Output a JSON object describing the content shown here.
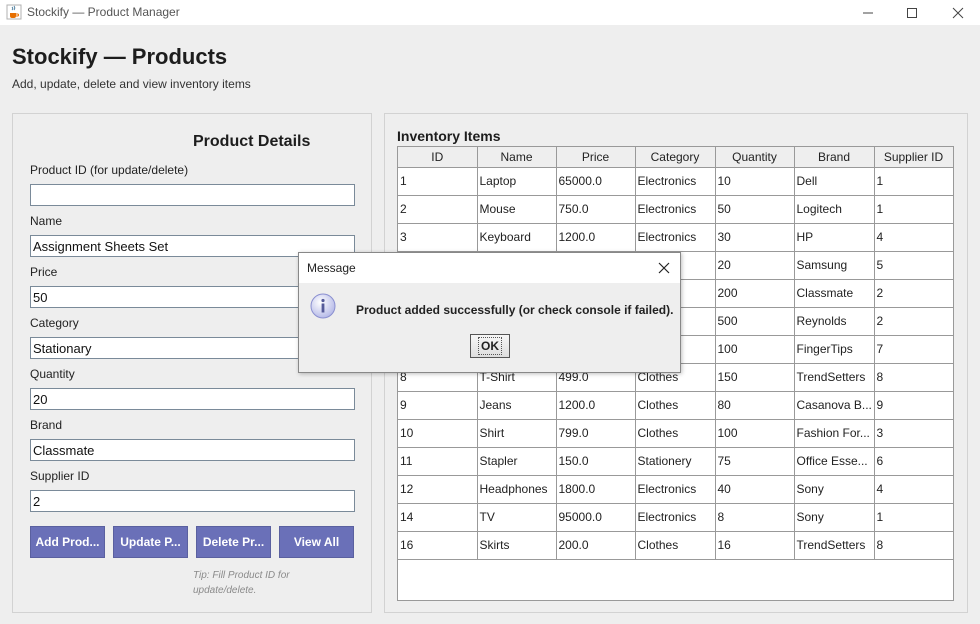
{
  "window": {
    "title": "Stockify — Product Manager",
    "icon": "java-cup-icon"
  },
  "header": {
    "title": "Stockify — Products",
    "subtitle": "Add, update, delete and view inventory items"
  },
  "details": {
    "title": "Product Details",
    "fields": {
      "product_id": {
        "label": "Product ID (for update/delete)",
        "value": ""
      },
      "name": {
        "label": "Name",
        "value": "Assignment Sheets Set"
      },
      "price": {
        "label": "Price",
        "value": "50"
      },
      "category": {
        "label": "Category",
        "value": "Stationary"
      },
      "quantity": {
        "label": "Quantity",
        "value": "20"
      },
      "brand": {
        "label": "Brand",
        "value": "Classmate"
      },
      "supplier_id": {
        "label": "Supplier ID",
        "value": "2"
      }
    },
    "buttons": {
      "add": "Add Prod...",
      "update": "Update P...",
      "delete": "Delete Pr...",
      "view_all": "View All"
    },
    "tip": "Tip: Fill Product ID for update/delete."
  },
  "inventory": {
    "title": "Inventory Items",
    "columns": [
      "ID",
      "Name",
      "Price",
      "Category",
      "Quantity",
      "Brand",
      "Supplier ID"
    ],
    "rows": [
      [
        "1",
        "Laptop",
        "65000.0",
        "Electronics",
        "10",
        "Dell",
        "1"
      ],
      [
        "2",
        "Mouse",
        "750.0",
        "Electronics",
        "50",
        "Logitech",
        "1"
      ],
      [
        "3",
        "Keyboard",
        "1200.0",
        "Electronics",
        "30",
        "HP",
        "4"
      ],
      [
        "",
        "",
        "",
        "ics",
        "20",
        "Samsung",
        "5"
      ],
      [
        "",
        "",
        "",
        "ry",
        "200",
        "Classmate",
        "2"
      ],
      [
        "",
        "",
        "",
        "ry",
        "500",
        "Reynolds",
        "2"
      ],
      [
        "",
        "",
        "",
        "ry",
        "100",
        "FingerTips",
        "7"
      ],
      [
        "8",
        "T-Shirt",
        "499.0",
        "Clothes",
        "150",
        "TrendSetters",
        "8"
      ],
      [
        "9",
        "Jeans",
        "1200.0",
        "Clothes",
        "80",
        "Casanova B...",
        "9"
      ],
      [
        "10",
        "Shirt",
        "799.0",
        "Clothes",
        "100",
        "Fashion For...",
        "3"
      ],
      [
        "11",
        "Stapler",
        "150.0",
        "Stationery",
        "75",
        "Office Esse...",
        "6"
      ],
      [
        "12",
        "Headphones",
        "1800.0",
        "Electronics",
        "40",
        "Sony",
        "4"
      ],
      [
        "14",
        "TV",
        "95000.0",
        "Electronics",
        "8",
        "Sony",
        "1"
      ],
      [
        "16",
        "Skirts",
        "200.0",
        "Clothes",
        "16",
        "TrendSetters",
        "8"
      ]
    ]
  },
  "dialog": {
    "title": "Message",
    "message": "Product added successfully (or check console if failed).",
    "ok_label": "OK",
    "icon": "info-icon"
  },
  "colors": {
    "button_bg": "#6a70b8",
    "window_bg": "#eeeeee",
    "info_icon": "#8a8fd0"
  }
}
